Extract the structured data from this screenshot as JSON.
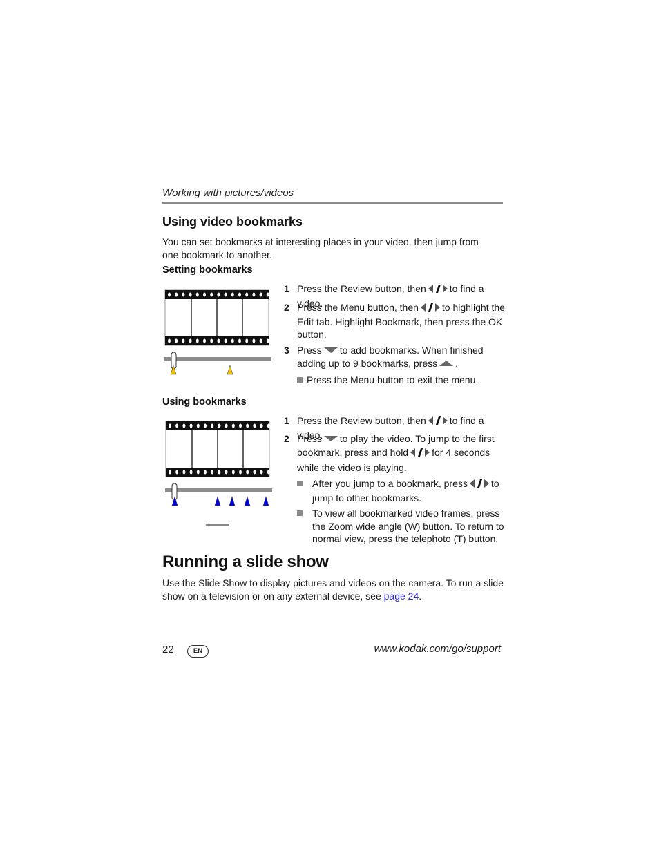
{
  "header": {
    "running_head": "Working with pictures/videos"
  },
  "section_bookmarks": {
    "title": "Using video bookmarks",
    "intro": "You can set bookmarks at interesting places in your video, then jump from one bookmark to another.",
    "setting": {
      "title": "Setting bookmarks",
      "steps": [
        {
          "num": "1",
          "pre": "Press the Review button, then",
          "icon": "left-right-arrows-icon",
          "post": "to find a video."
        },
        {
          "num": "2",
          "pre": "Press the Menu button, then",
          "icon": "left-right-arrows-icon",
          "post": "to highlight the Edit tab. Highlight Bookmark, then press the OK button."
        },
        {
          "num": "3",
          "pre": "Press",
          "icon": "down-arrow-icon",
          "mid": "to add bookmarks. When finished adding up to 9 bookmarks, press",
          "icon2": "up-arrow-icon",
          "post": "."
        }
      ],
      "bullets": [
        "Press the Menu button to exit the menu."
      ],
      "illustration": {
        "marker_color": "#f2c400",
        "marker_count": 2
      }
    },
    "using": {
      "title": "Using bookmarks",
      "steps": [
        {
          "num": "1",
          "pre": "Press the Review button, then",
          "icon": "left-right-arrows-icon",
          "post": "to find a video."
        },
        {
          "num": "2",
          "pre": "Press",
          "icon": "down-arrow-icon",
          "mid": "to play the video. To jump to the first bookmark, press and hold",
          "icon2": "left-right-arrows-icon",
          "post": "for 4 seconds while the video is playing."
        }
      ],
      "bullets": [
        {
          "pre": "After you jump to a bookmark, press",
          "icon": "left-right-arrows-icon",
          "post": "to jump to other bookmarks."
        },
        {
          "text": "To view all bookmarked video frames, press the Zoom wide angle (W) button. To return to normal view, press the telephoto (T) button."
        }
      ],
      "illustration": {
        "marker_color": "#0000dd",
        "marker_count": 5
      }
    }
  },
  "section_slideshow": {
    "title": "Running a slide show",
    "body_pre": "Use the Slide Show to display pictures and videos on the camera. To run a slide show on a television or on any external device, see",
    "link": "page 24",
    "body_post": "."
  },
  "footer": {
    "page_number": "22",
    "language_badge": "EN",
    "url": "www.kodak.com/go/support"
  }
}
